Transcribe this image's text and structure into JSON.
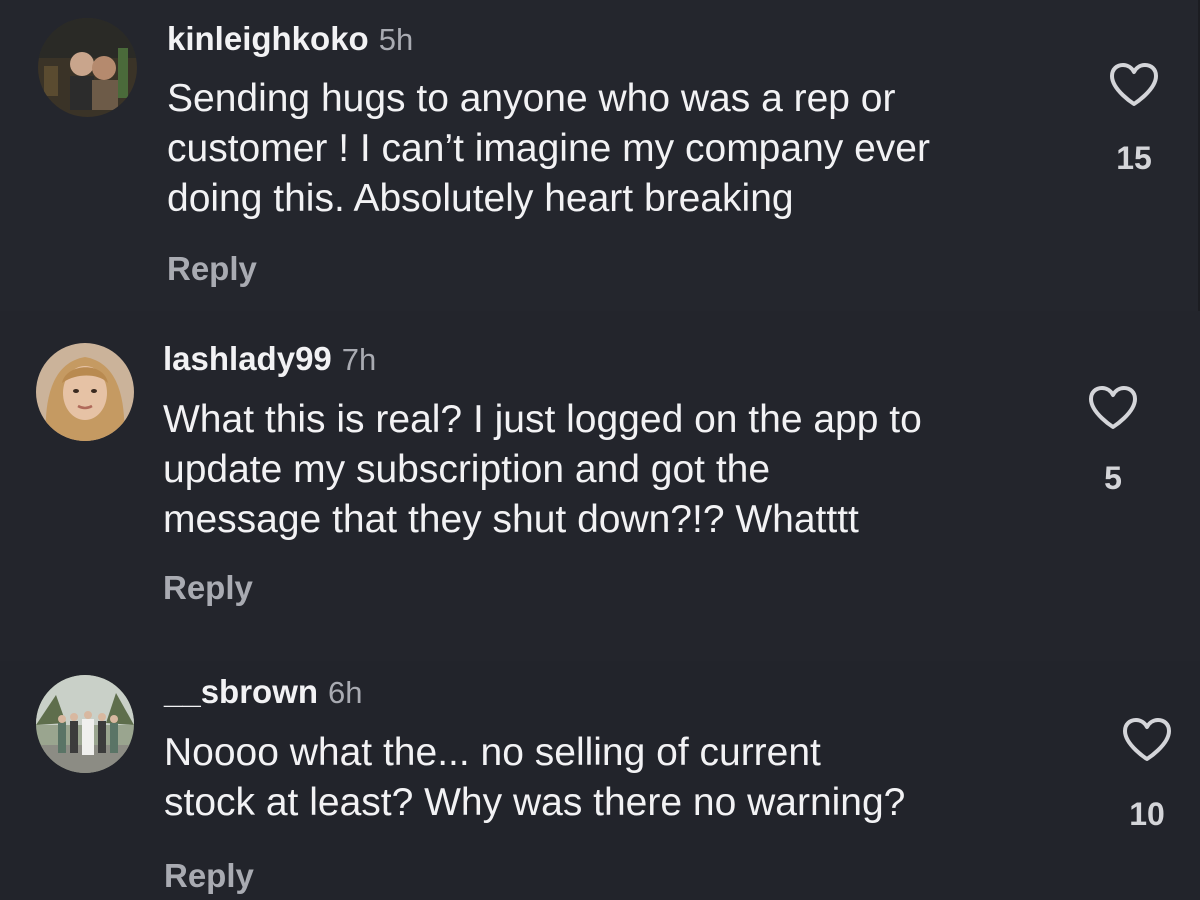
{
  "comments": [
    {
      "username": "kinleighkoko",
      "time": "5h",
      "text": "Sending hugs to anyone who was a rep or\ncustomer ! I can’t imagine my company ever\ndoing this.  Absolutely heart breaking",
      "reply_label": "Reply",
      "likes": "15",
      "avatar_icon": "avatar-couple-photo-icon",
      "like_icon": "heart-outline-icon"
    },
    {
      "username": "lashlady99",
      "time": "7h",
      "text": "What this is real? I just logged on the app to\nupdate my subscription and got the\nmessage that they shut down?!? Whatttt",
      "reply_label": "Reply",
      "likes": "5",
      "avatar_icon": "avatar-portrait-photo-icon",
      "like_icon": "heart-outline-icon"
    },
    {
      "username": "__sbrown",
      "time": "6h",
      "text": "Noooo what the... no selling of current\nstock at least? Why was there no warning?",
      "reply_label": "Reply",
      "likes": "10",
      "avatar_icon": "avatar-group-photo-icon",
      "like_icon": "heart-outline-icon"
    }
  ],
  "colors": {
    "background": "#24262d",
    "primary_text": "#f2f2f4",
    "secondary_text": "#a9abb2"
  }
}
